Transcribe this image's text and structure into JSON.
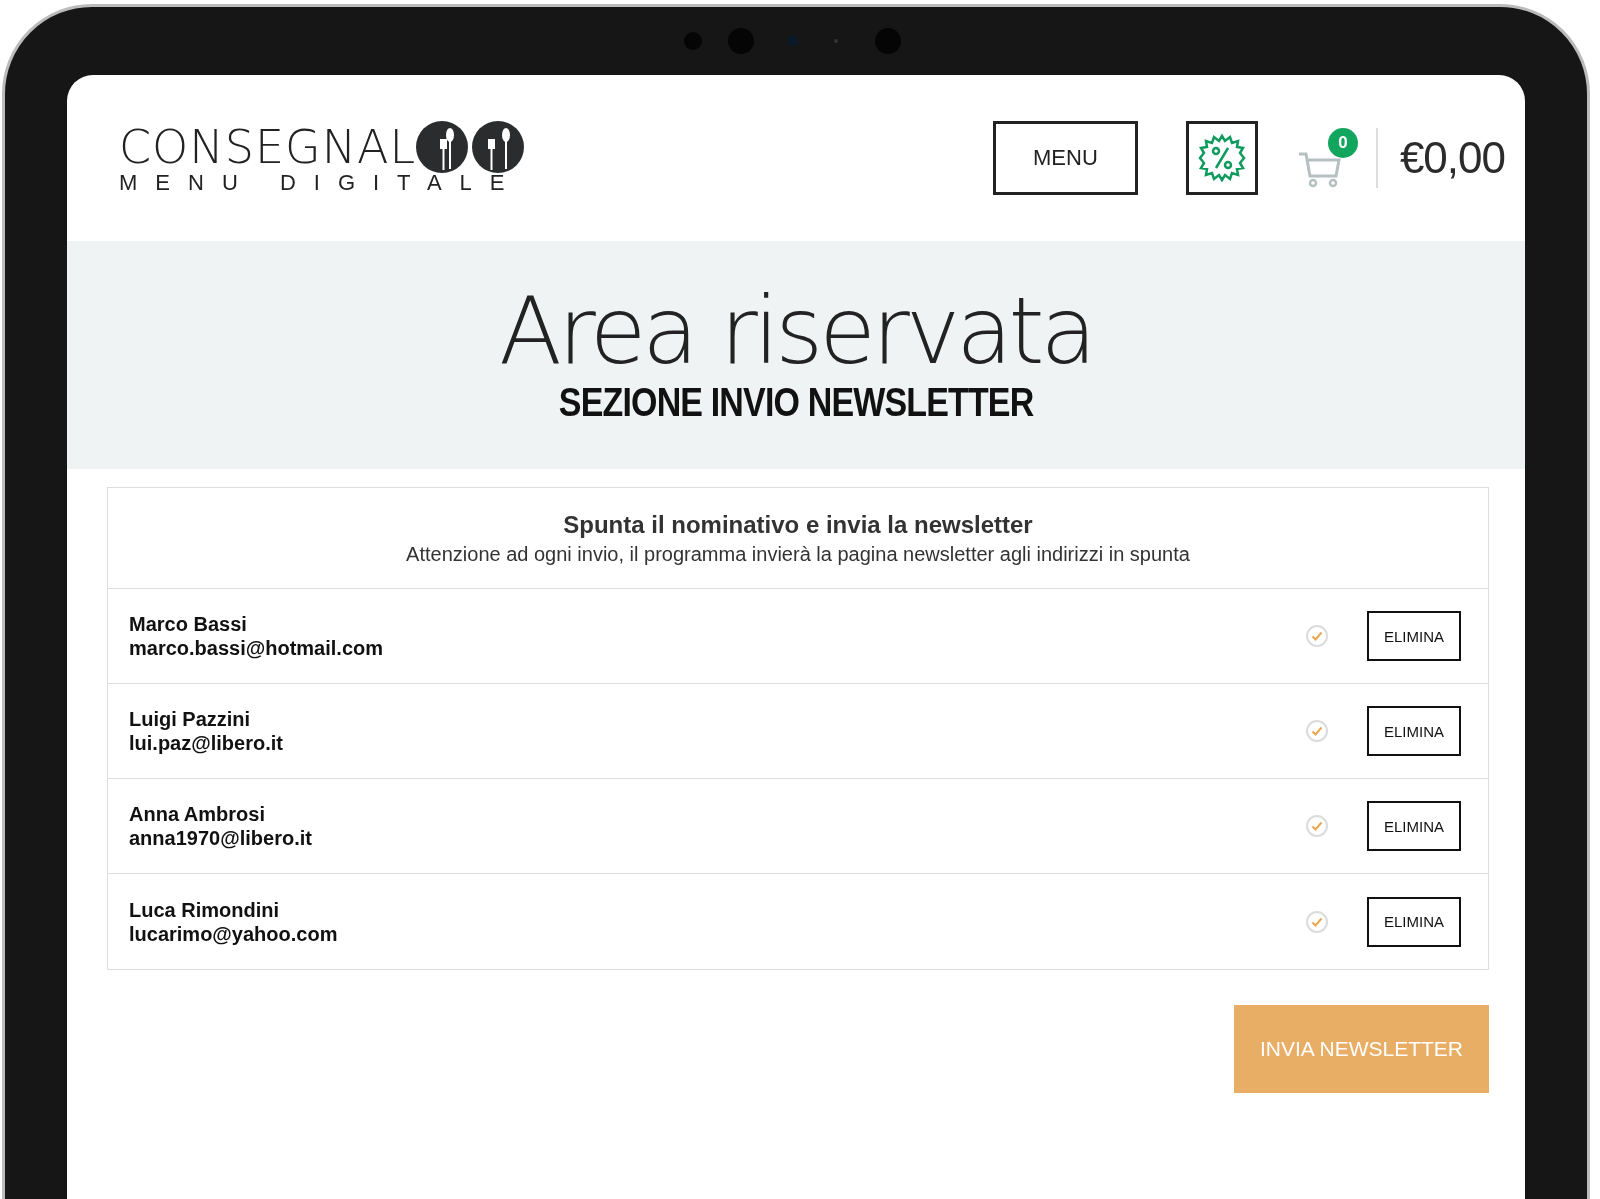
{
  "header": {
    "logo": {
      "name": "CONSEGNAL",
      "tagline": "MENU DIGITALE"
    },
    "menu_button": "MENU",
    "cart": {
      "count": "0"
    },
    "total": "€0,00"
  },
  "hero": {
    "title": "Area riservata",
    "subtitle": "SEZIONE INVIO NEWSLETTER"
  },
  "panel": {
    "heading": "Spunta il nominativo e invia la newsletter",
    "note": "Attenzione ad ogni invio, il programma invierà la pagina newsletter agli indirizzi in spunta"
  },
  "contacts": [
    {
      "name": "Marco Bassi",
      "email": "marco.bassi@hotmail.com",
      "checked": true,
      "action": "ELIMINA"
    },
    {
      "name": "Luigi Pazzini",
      "email": "lui.paz@libero.it",
      "checked": true,
      "action": "ELIMINA"
    },
    {
      "name": "Anna Ambrosi",
      "email": "anna1970@libero.it",
      "checked": true,
      "action": "ELIMINA"
    },
    {
      "name": "Luca Rimondini",
      "email": "lucarimo@yahoo.com",
      "checked": true,
      "action": "ELIMINA"
    }
  ],
  "send_button": "INVIA NEWSLETTER"
}
